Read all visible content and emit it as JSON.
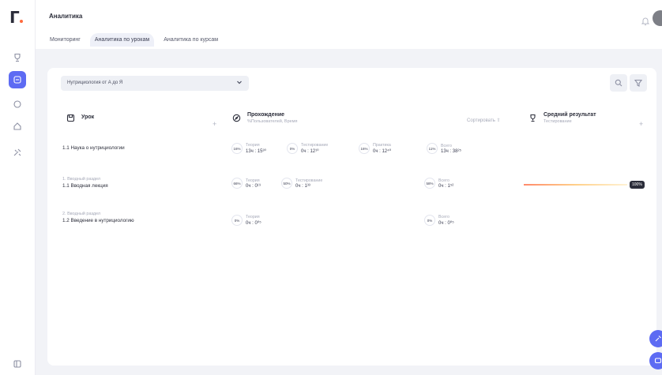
{
  "sidebar": {
    "logo": "Г",
    "icons": [
      "trophy-icon",
      "book-icon",
      "circle-icon",
      "home-icon",
      "tools-icon",
      "sidebar-collapse-icon"
    ]
  },
  "header": {
    "title": "Аналитика",
    "tabs": [
      {
        "label": "Мониторинг",
        "active": false
      },
      {
        "label": "Аналитика по урокам",
        "active": true
      },
      {
        "label": "Аналитика по курсам",
        "active": false
      }
    ]
  },
  "filter": {
    "selected": "Нутрициология от А до Я"
  },
  "table": {
    "col_lesson": {
      "title": "Урок"
    },
    "col_progress": {
      "title": "Прохождение",
      "subtitle": "%Пользователей, Время"
    },
    "sort_label": "Сортировать ⇧",
    "col_result": {
      "title": "Средний результат",
      "subtitle": "Тестирование"
    },
    "rows": [
      {
        "section": "",
        "name": "1.1 Наука о нутрициологии",
        "metrics": [
          {
            "ring": "16%",
            "label": "Теория",
            "value": "13ч : 15³⁰"
          },
          {
            "ring": "0%",
            "label": "Тестирование",
            "value": "0ч : 12¹⁰"
          },
          {
            "ring": "16%",
            "label": "Практика",
            "value": "0ч : 12⁴⁰"
          },
          {
            "ring": "11%",
            "label": "Всего",
            "value": "13ч : 38²⁵"
          }
        ],
        "result": ""
      },
      {
        "section": "1. Вводный раздел",
        "name": "1.1 Вводная лекция",
        "metrics": [
          {
            "ring": "66%",
            "label": "Теория",
            "value": "0ч : 0¹⁹"
          },
          {
            "ring": "50%",
            "label": "Тестирование",
            "value": "0ч : 1³³"
          },
          {
            "ring": "58%",
            "label": "Всего",
            "value": "0ч : 1⁵²"
          }
        ],
        "result": "100%"
      },
      {
        "section": "2. Вводный раздел",
        "name": "1.2 Введение в нутрициологию",
        "metrics": [
          {
            "ring": "0%",
            "label": "Теория",
            "value": "0ч : 0⁰⁵"
          },
          {
            "ring": "0%",
            "label": "Всего",
            "value": "0ч : 0⁰⁵"
          }
        ],
        "result": ""
      }
    ]
  },
  "colors": {
    "accent": "#5d6bf3",
    "logo_dot": "#ff6a3d",
    "result_bar_start": "#ff8a6b"
  }
}
